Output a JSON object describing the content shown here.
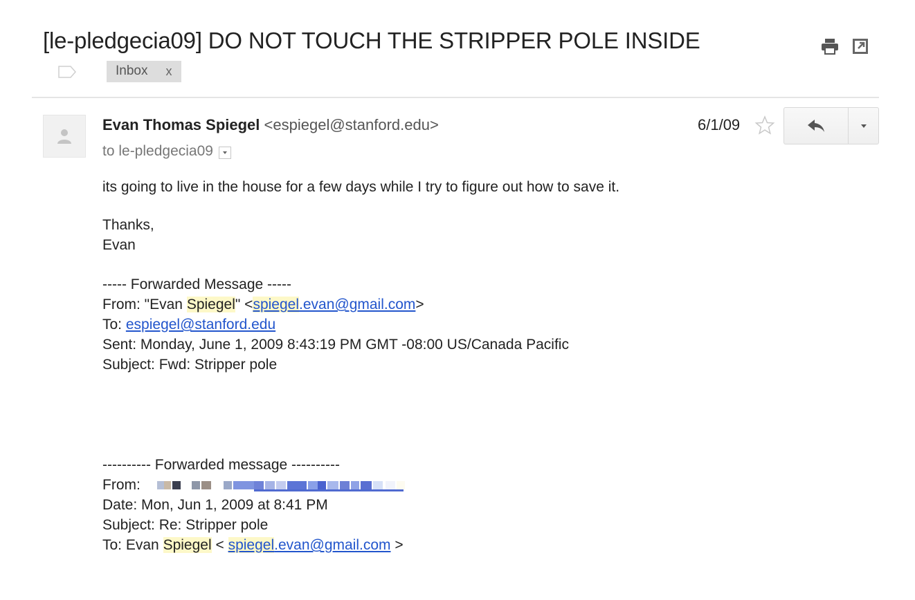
{
  "subject": "[le-pledgecia09] DO NOT TOUCH THE STRIPPER POLE INSIDE",
  "label": {
    "name": "Inbox",
    "remove": "x"
  },
  "sender": {
    "name": "Evan Thomas Spiegel",
    "email": "<espiegel@stanford.edu>"
  },
  "recipient": "to le-pledgecia09",
  "date": "6/1/09",
  "icons": {
    "print": "print-icon",
    "new_window": "new-window-icon",
    "avatar": "person-icon",
    "star": "star-icon",
    "reply": "reply-icon",
    "more": "chevron-down-icon",
    "details": "chevron-down-icon"
  },
  "colors": {
    "link": "#2255cc",
    "highlight": "#fdf8c8",
    "label_chip": "#dddddd"
  },
  "body": {
    "intro": "its going to live in the house for a few days while I try to figure out how to save it.",
    "thanks": "Thanks,",
    "signoff": "Evan",
    "fwd1": {
      "header": "----- Forwarded Message -----",
      "from_prefix": "From: \"Evan ",
      "from_name_hl": "Spiegel",
      "from_mid": "\" <",
      "from_link_hl": "spiegel",
      "from_link_rest": ".evan@gmail.com",
      "from_suffix": ">",
      "to_prefix": "To: ",
      "to_link": "espiegel@stanford.edu",
      "sent": "Sent: Monday, June 1, 2009 8:43:19 PM GMT -08:00 US/Canada Pacific",
      "subject": "Subject: Fwd: Stripper pole"
    },
    "fwd2": {
      "header": "---------- Forwarded message ----------",
      "from_label": "From:",
      "date": "Date: Mon, Jun 1, 2009 at 8:41 PM",
      "subject": "Subject: Re: Stripper pole",
      "to_prefix": "To: Evan ",
      "to_name_hl": "Spiegel",
      "to_mid": " < ",
      "to_link_hl": "spiegel",
      "to_link_rest": ".evan@gmail.com",
      "to_suffix": " >"
    }
  }
}
